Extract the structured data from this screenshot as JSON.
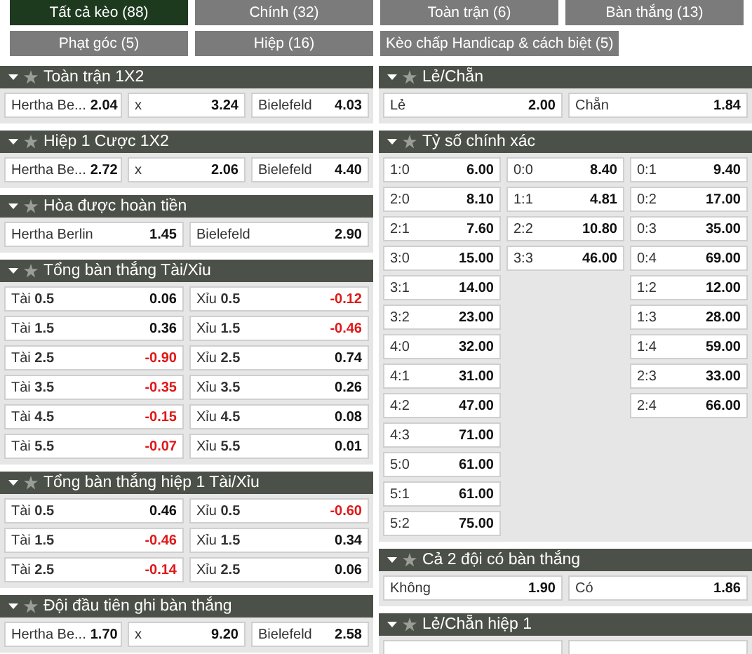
{
  "tabs": [
    {
      "label": "Tất cả kèo (88)",
      "selected": true
    },
    {
      "label": "Chính (32)",
      "selected": false
    },
    {
      "label": "Toàn trận (6)",
      "selected": false
    },
    {
      "label": "Bàn thắng (13)",
      "selected": false
    },
    {
      "label": "Phạt góc (5)",
      "selected": false
    },
    {
      "label": "Hiệp (16)",
      "selected": false
    },
    {
      "label": "Kèo chấp Handicap & cách biệt (5)",
      "selected": false
    }
  ],
  "left_panels": [
    {
      "title": "Toàn trận 1X2",
      "kind": "grid",
      "rows": [
        [
          {
            "label": "Hertha Be...",
            "value": "2.04"
          },
          {
            "label": "x",
            "value": "3.24"
          },
          {
            "label": "Bielefeld",
            "value": "4.03"
          }
        ]
      ]
    },
    {
      "title": "Hiệp 1 Cược 1X2",
      "kind": "grid",
      "rows": [
        [
          {
            "label": "Hertha Be...",
            "value": "2.72"
          },
          {
            "label": "x",
            "value": "2.06"
          },
          {
            "label": "Bielefeld",
            "value": "4.40"
          }
        ]
      ]
    },
    {
      "title": "Hòa được hoàn tiền",
      "kind": "grid",
      "rows": [
        [
          {
            "label": "Hertha Berlin",
            "value": "1.45"
          },
          {
            "label": "Bielefeld",
            "value": "2.90"
          }
        ]
      ]
    },
    {
      "title": "Tổng bàn thắng Tài/Xỉu",
      "kind": "grid",
      "rows": [
        [
          {
            "label": "Tài **0.5**",
            "value": "0.06",
            "negative": false
          },
          {
            "label": "Xỉu **0.5**",
            "value": "-0.12",
            "negative": true
          }
        ],
        [
          {
            "label": "Tài **1.5**",
            "value": "0.36",
            "negative": false
          },
          {
            "label": "Xỉu **1.5**",
            "value": "-0.46",
            "negative": true
          }
        ],
        [
          {
            "label": "Tài **2.5**",
            "value": "-0.90",
            "negative": true
          },
          {
            "label": "Xỉu **2.5**",
            "value": "0.74",
            "negative": false
          }
        ],
        [
          {
            "label": "Tài **3.5**",
            "value": "-0.35",
            "negative": true
          },
          {
            "label": "Xỉu **3.5**",
            "value": "0.26",
            "negative": false
          }
        ],
        [
          {
            "label": "Tài **4.5**",
            "value": "-0.15",
            "negative": true
          },
          {
            "label": "Xỉu **4.5**",
            "value": "0.08",
            "negative": false
          }
        ],
        [
          {
            "label": "Tài **5.5**",
            "value": "-0.07",
            "negative": true
          },
          {
            "label": "Xỉu **5.5**",
            "value": "0.01",
            "negative": false
          }
        ]
      ]
    },
    {
      "title": "Tổng bàn thắng hiệp 1 Tài/Xỉu",
      "kind": "grid",
      "rows": [
        [
          {
            "label": "Tài **0.5**",
            "value": "0.46",
            "negative": false
          },
          {
            "label": "Xỉu **0.5**",
            "value": "-0.60",
            "negative": true
          }
        ],
        [
          {
            "label": "Tài **1.5**",
            "value": "-0.46",
            "negative": true
          },
          {
            "label": "Xỉu **1.5**",
            "value": "0.34",
            "negative": false
          }
        ],
        [
          {
            "label": "Tài **2.5**",
            "value": "-0.14",
            "negative": true
          },
          {
            "label": "Xỉu **2.5**",
            "value": "0.06",
            "negative": false
          }
        ]
      ]
    },
    {
      "title": "Đội đầu tiên ghi bàn thắng",
      "kind": "grid",
      "rows": [
        [
          {
            "label": "Hertha Be...",
            "value": "1.70"
          },
          {
            "label": "x",
            "value": "9.20"
          },
          {
            "label": "Bielefeld",
            "value": "2.58"
          }
        ]
      ]
    }
  ],
  "right_panels": [
    {
      "title": "Lẻ/Chẵn",
      "kind": "grid",
      "rows": [
        [
          {
            "label": "Lẻ",
            "value": "2.00"
          },
          {
            "label": "Chẵn",
            "value": "1.84"
          }
        ]
      ]
    },
    {
      "title": "Tỷ số chính xác",
      "kind": "columns",
      "columns": [
        [
          {
            "label": "1:0",
            "value": "6.00"
          },
          {
            "label": "2:0",
            "value": "8.10"
          },
          {
            "label": "2:1",
            "value": "7.60"
          },
          {
            "label": "3:0",
            "value": "15.00"
          },
          {
            "label": "3:1",
            "value": "14.00"
          },
          {
            "label": "3:2",
            "value": "23.00"
          },
          {
            "label": "4:0",
            "value": "32.00"
          },
          {
            "label": "4:1",
            "value": "31.00"
          },
          {
            "label": "4:2",
            "value": "47.00"
          },
          {
            "label": "4:3",
            "value": "71.00"
          },
          {
            "label": "5:0",
            "value": "61.00"
          },
          {
            "label": "5:1",
            "value": "61.00"
          },
          {
            "label": "5:2",
            "value": "75.00"
          }
        ],
        [
          {
            "label": "0:0",
            "value": "8.40"
          },
          {
            "label": "1:1",
            "value": "4.81"
          },
          {
            "label": "2:2",
            "value": "10.80"
          },
          {
            "label": "3:3",
            "value": "46.00"
          }
        ],
        [
          {
            "label": "0:1",
            "value": "9.40"
          },
          {
            "label": "0:2",
            "value": "17.00"
          },
          {
            "label": "0:3",
            "value": "35.00"
          },
          {
            "label": "0:4",
            "value": "69.00"
          },
          {
            "label": "1:2",
            "value": "12.00"
          },
          {
            "label": "1:3",
            "value": "28.00"
          },
          {
            "label": "1:4",
            "value": "59.00"
          },
          {
            "label": "2:3",
            "value": "33.00"
          },
          {
            "label": "2:4",
            "value": "66.00"
          }
        ]
      ]
    },
    {
      "title": "Cả 2 đội có bàn thắng",
      "kind": "grid",
      "rows": [
        [
          {
            "label": "Không",
            "value": "1.90"
          },
          {
            "label": "Có",
            "value": "1.86"
          }
        ]
      ]
    },
    {
      "title": "Lẻ/Chẵn hiệp 1",
      "kind": "grid",
      "rows": [
        [
          {},
          {}
        ]
      ]
    }
  ]
}
